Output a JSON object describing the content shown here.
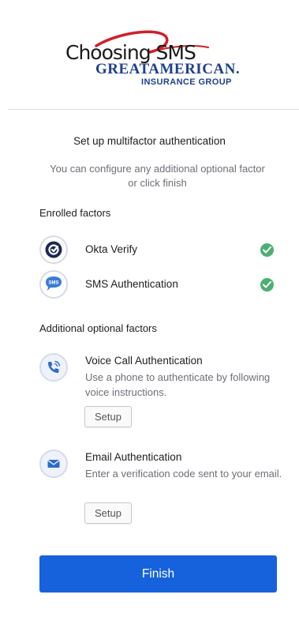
{
  "logo": {
    "caption": "Choosing SMS",
    "name": "GREATAMERICAN.",
    "subname": "INSURANCE GROUP",
    "brand_color": "#1f3f8f",
    "swoosh_color": "#cf1f2a"
  },
  "form": {
    "title": "Set up multifactor authentication",
    "subtitle": "You can configure any additional optional factor or click finish"
  },
  "enrolled": {
    "heading": "Enrolled factors",
    "factors": [
      {
        "name": "Okta Verify",
        "icon": "okta-verify-icon",
        "status": "enrolled"
      },
      {
        "name": "SMS Authentication",
        "icon": "sms-icon",
        "status": "enrolled"
      }
    ]
  },
  "optional": {
    "heading": "Additional optional factors",
    "factors": [
      {
        "name": "Voice Call Authentication",
        "icon": "phone-call-icon",
        "description": "Use a phone to authenticate by following voice instructions.",
        "button": "Setup"
      },
      {
        "name": "Email Authentication",
        "icon": "envelope-icon",
        "description": "Enter a verification code sent to your email.",
        "button": "Setup"
      }
    ]
  },
  "finish_label": "Finish",
  "colors": {
    "primary": "#1662dd",
    "success": "#4caf71",
    "muted": "#6e6e78"
  }
}
